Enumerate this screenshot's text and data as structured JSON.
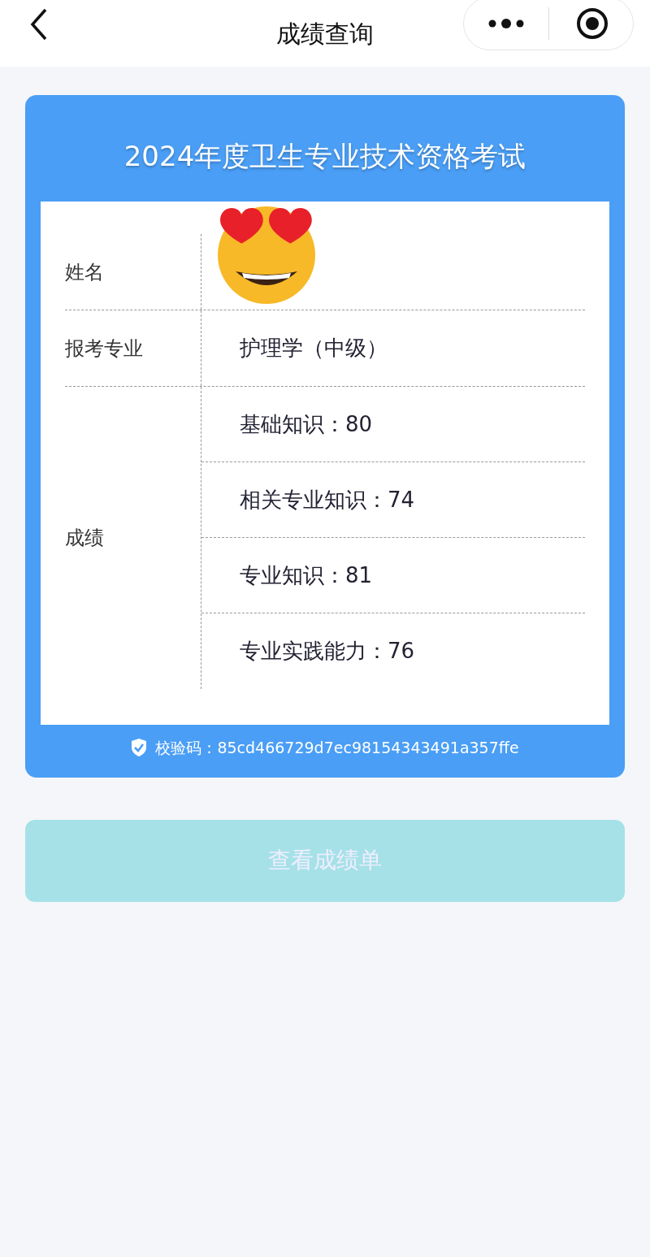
{
  "nav": {
    "title": "成绩查询"
  },
  "exam_title": "2024年度卫生专业技术资格考试",
  "fields": [
    {
      "label": "姓名",
      "kind": "sticker"
    },
    {
      "label": "报考专业",
      "kind": "text",
      "value": "护理学（中级）"
    },
    {
      "label": "成绩",
      "kind": "list",
      "items": [
        "基础知识：80",
        "相关专业知识：74",
        "专业知识：81",
        "专业实践能力：76"
      ]
    }
  ],
  "verification": {
    "label": "校验码：",
    "code": "85cd466729d7ec98154343491a357ffe"
  },
  "button": {
    "label": "查看成绩单",
    "disabled": true
  }
}
